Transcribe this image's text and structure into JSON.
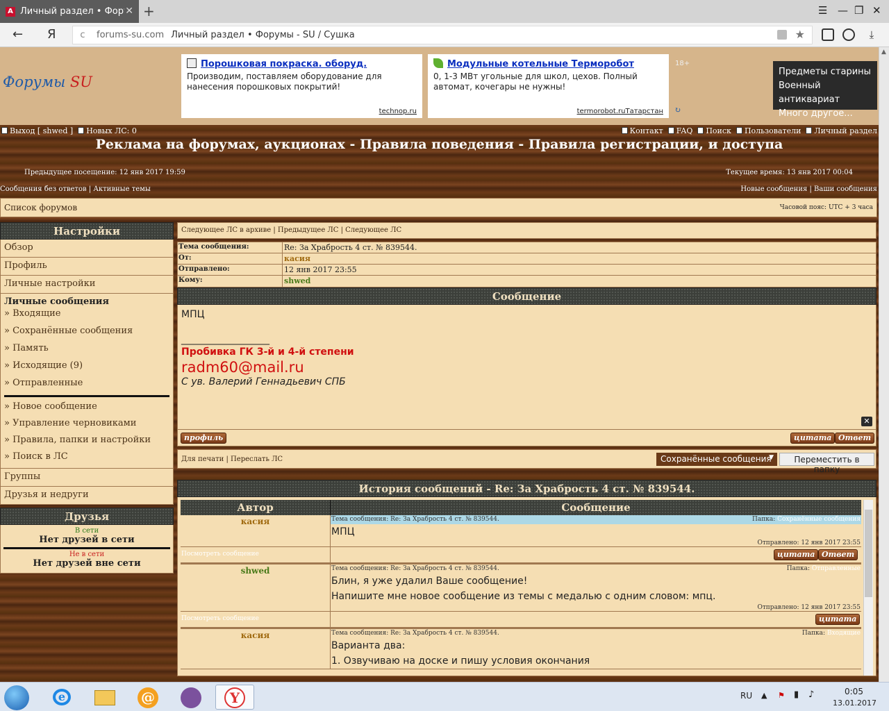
{
  "browser": {
    "tab_title": "Личный раздел • Форумы",
    "tab_favicon": "А",
    "tab_close": "✕",
    "new_tab": "+",
    "back": "←",
    "yandex": "Я",
    "reload": "c",
    "url_domain": "forums-su.com",
    "url_title": "Личный раздел • Форумы - SU / Сушка",
    "star": "★",
    "menu": "☰",
    "minimize": "—",
    "restore": "❐",
    "close": "✕",
    "download": "⤓",
    "icons": [
      "lock-icon",
      "star-icon",
      "extension-icon",
      "protect-icon",
      "download-icon"
    ]
  },
  "header": {
    "logo_main": "Форумы",
    "logo_su": "SU",
    "ads": [
      {
        "title": "Порошковая покраска. оборуд.",
        "text": "Производим, поставляем оборудование для нанесения порошковых покрытий!",
        "source": "technop.ru",
        "icon": "powder-ad-icon"
      },
      {
        "title": "Модульные котельные Терморобот",
        "text": "0, 1-3 МВт угольные для школ, цехов. Полный автомат, кочегары не нужны!",
        "source": "termorobot.ruТатарстан",
        "icon": "leaf-icon"
      }
    ],
    "age": "18+",
    "ad_badge": "↻",
    "promo_lines": [
      "Предметы старины",
      "Военный антиквариат",
      "Много другое..."
    ]
  },
  "topnav": {
    "logout": "Выход [ shwed ]",
    "new_pm": "Новых ЛС: 0",
    "right_items": [
      "Контакт",
      "FAQ",
      "Поиск",
      "Пользователи",
      "Личный раздел"
    ]
  },
  "site_title": "Реклама на форумах, аукционах - Правила поведения - Правила регистрации, и доступа",
  "visits": {
    "previous": "Предыдущее посещение: 12 янв 2017 19:59",
    "current": "Текущее время: 13 янв 2017 00:04"
  },
  "links": {
    "left": "Сообщения без ответов | Активные темы",
    "right": "Новые сообщения | Ваши сообщения"
  },
  "breadcrumb": {
    "forum_list": "Список форумов",
    "timezone": "Часовой пояс: UTC + 3 часа"
  },
  "sidebar": {
    "title": "Настройки",
    "items": [
      "Обзор",
      "Профиль",
      "Личные настройки"
    ],
    "pm_title": "Личные сообщения",
    "pm_items": [
      "» Входящие",
      "» Сохранённые сообщения",
      "» Память",
      "» Исходящие (9)",
      "» Отправленные"
    ],
    "pm_actions": [
      "» Новое сообщение",
      "» Управление черновиками",
      "» Правила, папки и настройки",
      "» Поиск в ЛС"
    ],
    "bottom_items": [
      "Группы",
      "Друзья и недруги"
    ]
  },
  "friends": {
    "title": "Друзья",
    "online_label": "В сети",
    "online_msg": "Нет друзей в сети",
    "offline_label": "Не в сети",
    "offline_msg": "Нет друзей вне сети"
  },
  "message": {
    "nav": "Следующее ЛС в архиве | Предыдущее ЛС | Следующее ЛС",
    "labels": {
      "subject": "Тема сообщения:",
      "from": "От:",
      "sent": "Отправлено:",
      "to": "Кому:"
    },
    "subject": "Re: За Храбрость 4 ст. № 839544.",
    "from": "касия",
    "sent": "12 янв 2017 23:55",
    "to": "shwed",
    "header": "Сообщение",
    "body": "МПЦ",
    "sig_line": "_____________________",
    "sig_red": "Пробивка ГК 3-й и 4-й степени",
    "sig_email": "radm60@mail.ru",
    "sig_name": "С ув. Валерий Геннадьевич СПБ",
    "close_x": "✕",
    "btn_profile": "профиль",
    "btn_quote": "цитата",
    "btn_reply": "Ответ"
  },
  "actions": {
    "left": "Для печати | Переслать ЛС",
    "folder": "Сохранённые сообщения",
    "folder_arrow": "▼",
    "move": "Переместить в папку"
  },
  "history": {
    "title": "История сообщений - Re: За Храбрость 4 ст. № 839544.",
    "col_author": "Автор",
    "col_message": "Сообщение",
    "subject_label": "Тема сообщения:",
    "folder_label": "Папка:",
    "sent_label": "Отправлено:",
    "view_label": "Посмотреть сообщение",
    "posts": [
      {
        "author": "касия",
        "author_color": "#a06a10",
        "subject": "Re: За Храбрость 4 ст. № 839544.",
        "folder": "Сохранённые сообщения",
        "lines": [
          "МПЦ"
        ],
        "sent": "12 янв 2017 23:55",
        "highlight": true
      },
      {
        "author": "shwed",
        "author_color": "#4a7a1a",
        "subject": "Re: За Храбрость 4 ст. № 839544.",
        "folder": "Отправленные",
        "lines": [
          "Блин, я уже удалил Ваше сообщение!",
          "Напишите мне новое сообщение из темы с медалью с одним словом: мпц."
        ],
        "sent": "12 янв 2017 23:55",
        "highlight": false
      },
      {
        "author": "касия",
        "author_color": "#a06a10",
        "subject": "Re: За Храбрость 4 ст. № 839544.",
        "folder": "Входящие",
        "lines": [
          "Варианта два:",
          "1. Озвучиваю на доске и пишу условия окончания"
        ],
        "sent": "",
        "highlight": false
      }
    ]
  },
  "taskbar": {
    "lang": "RU",
    "time": "0:05",
    "date": "13.01.2017",
    "apps": [
      "windows-start-icon",
      "internet-explorer-icon",
      "file-explorer-icon",
      "mail-agent-icon",
      "viber-icon",
      "yandex-browser-icon"
    ]
  },
  "colors": {
    "wood": "#6b3a18",
    "panel": "#f5deb3",
    "dark_header": "#3c3f3a",
    "red": "#d01010",
    "link_blue": "#0b2fbf"
  }
}
